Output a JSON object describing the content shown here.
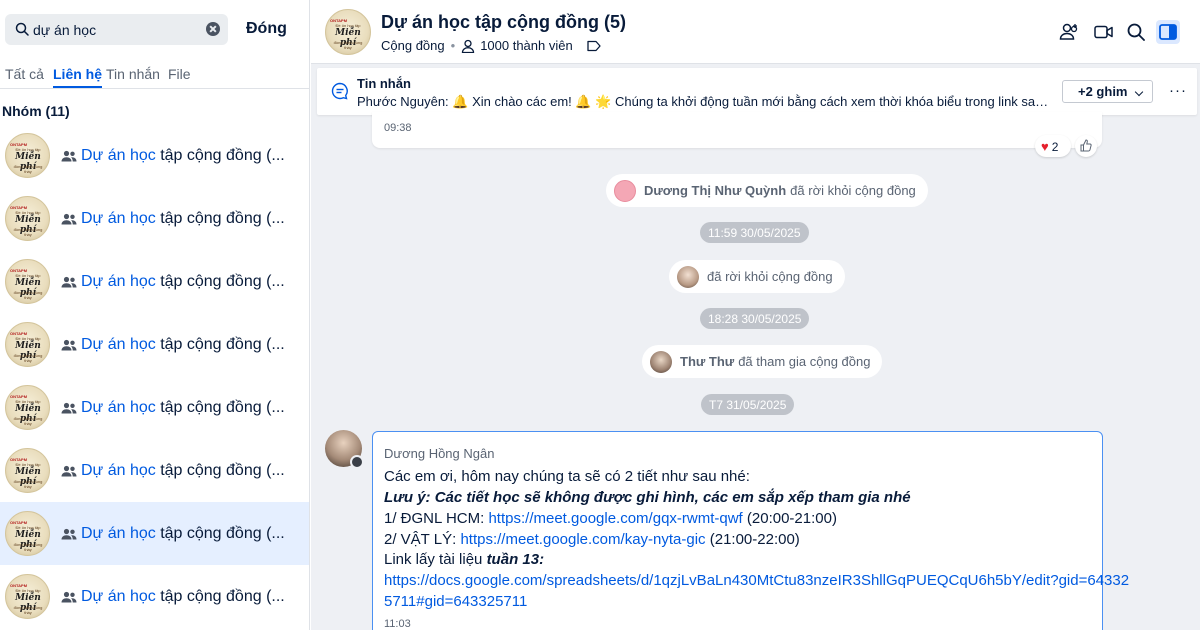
{
  "search": {
    "value": "dự án học"
  },
  "sidebar": {
    "close_label": "Đóng",
    "tabs": [
      {
        "label": "Tất cả"
      },
      {
        "label": "Liên hệ",
        "active": true
      },
      {
        "label": "Tin nhắn"
      },
      {
        "label": "File"
      }
    ],
    "group_heading": "Nhóm (11)",
    "results": [
      {
        "highlight": "Dự án học",
        "rest": " tập cộng đồng (..."
      },
      {
        "highlight": "Dự án học",
        "rest": " tập cộng đồng (..."
      },
      {
        "highlight": "Dự án học",
        "rest": " tập cộng đồng (..."
      },
      {
        "highlight": "Dự án học",
        "rest": " tập cộng đồng (..."
      },
      {
        "highlight": "Dự án học",
        "rest": " tập cộng đồng (..."
      },
      {
        "highlight": "Dự án học",
        "rest": " tập cộng đồng (..."
      },
      {
        "highlight": "Dự án học",
        "rest": " tập cộng đồng (...",
        "selected": true
      },
      {
        "highlight": "Dự án học",
        "rest": " tập cộng đồng (..."
      }
    ],
    "avatar_logo_text": {
      "top": "ONTAPM",
      "mid": "Đề ôn học tập",
      "script": "Miễn phí",
      "bottom": "đồng hành cùng thầy"
    }
  },
  "header": {
    "title": "Dự án học tập cộng đồng (5)",
    "type": "Cộng đồng",
    "members": "1000 thành viên"
  },
  "pinned": {
    "title": "Tin nhắn",
    "text": "Phước Nguyên: 🔔 Xin chào các em! 🔔 🌟 Chúng ta khởi động tuần mới bằng cách xem thời khóa biểu trong link sau nhé (ở sh...",
    "more_label": "+2 ghim",
    "menu_label": "···"
  },
  "messages": {
    "prev_time": "09:38",
    "reaction_count": "2",
    "events": [
      {
        "name": "Dương Thị Như Quỳnh",
        "text": "đã rời khỏi cộng đồng"
      },
      {
        "name": "",
        "text": "đã rời khỏi cộng đồng"
      },
      {
        "name": "Thư Thư",
        "text": "đã tham gia cộng đồng"
      }
    ],
    "timestamps": [
      "11:59 30/05/2025",
      "18:28 30/05/2025",
      "T7 31/05/2025"
    ],
    "main": {
      "sender": "Dương Hồng Ngân",
      "line1": "Các em ơi, hôm nay chúng ta sẽ có 2 tiết như sau nhé:",
      "line2": "Lưu ý: Các tiết học sẽ không được ghi hình, các em sắp xếp tham gia nhé",
      "line3_prefix": "1/ ĐGNL HCM: ",
      "line3_link": "https://meet.google.com/gqx-rwmt-qwf",
      "line3_suffix": " (20:00-21:00)",
      "line4_prefix": "2/ VẬT LÝ: ",
      "line4_link": "https://meet.google.com/kay-nyta-gic",
      "line4_suffix": " (21:00-22:00)",
      "line5_prefix": "Link lấy tài liệu ",
      "line5_em": "tuần 13:",
      "link_a": "https://docs.google.com/spreadsheets/d/1qzjLvBaLn430MtCtu83nzeIR3ShllGqPUEQCqU6h5bY/edit?gid=64332",
      "link_b": "5711#gid=643325711",
      "time": "11:03"
    }
  },
  "colors": {
    "accent": "#005ae0",
    "selected_bg": "#e5efff",
    "chat_bg": "#eef0f4",
    "heart": "#e5202d"
  }
}
